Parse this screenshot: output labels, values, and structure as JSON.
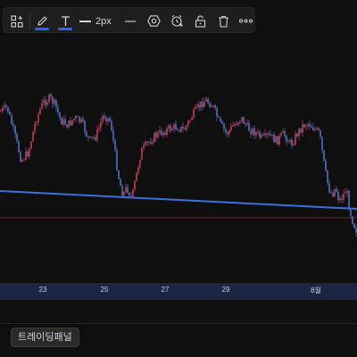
{
  "toolbar": {
    "accent_color": "#2962ff",
    "line_width_label": "2px",
    "items": [
      "drawing-templates-icon",
      "pencil-icon",
      "text-icon",
      "line-width",
      "line-style-icon",
      "settings-hexagon-icon",
      "add-alert-clock-icon",
      "lock-icon",
      "trash-icon",
      "more-icon"
    ]
  },
  "chart": {
    "candle_up_color": "#d94a5a",
    "candle_down_color": "#5b7fd9",
    "trendline_color": "#3b6fe0",
    "level_line_color": "#7a2a34"
  },
  "time_axis": {
    "ticks": [
      "23",
      "25",
      "27",
      "29",
      "8월"
    ]
  },
  "bottom": {
    "trading_panel_label": "트레이딩패널"
  }
}
